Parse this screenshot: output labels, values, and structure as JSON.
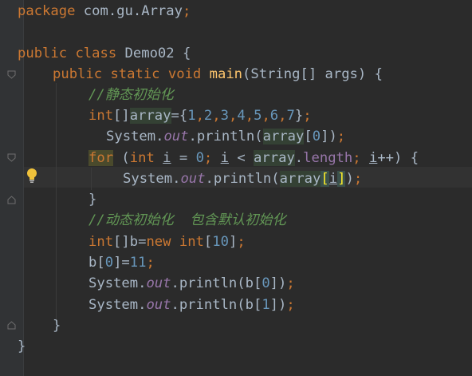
{
  "code": {
    "l1_pkg_kw": "package",
    "l1_pkg_name": " com.gu.Array",
    "l1_semi": ";",
    "l3_public": "public",
    "l3_class": " class",
    "l3_name": " Demo02 {",
    "l4_public": "public",
    "l4_static": " static",
    "l4_void": " void",
    "l4_main": " main",
    "l4_params": "(String[] args) {",
    "l5_comment": "//静态初始化",
    "l6_type": "int",
    "l6_brackets": "[]",
    "l6_var": "array",
    "l6_eq": "={",
    "l6_n1": "1",
    "l6_n2": "2",
    "l6_n3": "3",
    "l6_n4": "4",
    "l6_n5": "5",
    "l6_n6": "6",
    "l6_n7": "7",
    "l6_end": "}",
    "l6_semi": ";",
    "l7_sys": "System.",
    "l7_out": "out",
    "l7_println": ".println(",
    "l7_arr": "array",
    "l7_idx_open": "[",
    "l7_idx": "0",
    "l7_idx_close": "])",
    "l7_semi": ";",
    "l8_for": "for",
    "l8_paren": " (",
    "l8_int": "int",
    "l8_i": "i",
    "l8_eq": " = ",
    "l8_zero": "0",
    "l8_semi1": ";",
    "l8_i2": "i",
    "l8_lt": " < ",
    "l8_arr": "array",
    "l8_dot": ".",
    "l8_length": "length",
    "l8_semi2": ";",
    "l8_i3": "i",
    "l8_inc": "++) {",
    "l9_sys": "System.",
    "l9_out": "out",
    "l9_println": ".println(",
    "l9_arr": "array",
    "l9_open": "[",
    "l9_i": "i",
    "l9_close": "]",
    "l9_paren": ")",
    "l9_semi": ";",
    "l10_brace": "}",
    "l11_comment": "//动态初始化  包含默认初始化",
    "l12_int": "int",
    "l12_b": "[]b=",
    "l12_new": "new",
    "l12_int2": "int",
    "l12_open": "[",
    "l12_ten": "10",
    "l12_close": "]",
    "l12_semi": ";",
    "l13_b": "b[",
    "l13_zero": "0",
    "l13_eq": "]=",
    "l13_eleven": "11",
    "l13_semi": ";",
    "l14_sys": "System.",
    "l14_out": "out",
    "l14_println": ".println(b[",
    "l14_zero": "0",
    "l14_close": "])",
    "l14_semi": ";",
    "l15_sys": "System.",
    "l15_out": "out",
    "l15_println": ".println(b[",
    "l15_one": "1",
    "l15_close": "])",
    "l15_semi": ";",
    "l16_brace": "}",
    "l17_brace": "}"
  },
  "icons": {
    "bulb": "lightbulb-icon",
    "fold": "fold-marker-icon"
  },
  "colors": {
    "background": "#2b2b2b",
    "keyword": "#cc7832",
    "function": "#ffc66d",
    "number": "#6897bb",
    "field": "#9876aa",
    "comment": "#629755",
    "text": "#a9b7c6"
  }
}
